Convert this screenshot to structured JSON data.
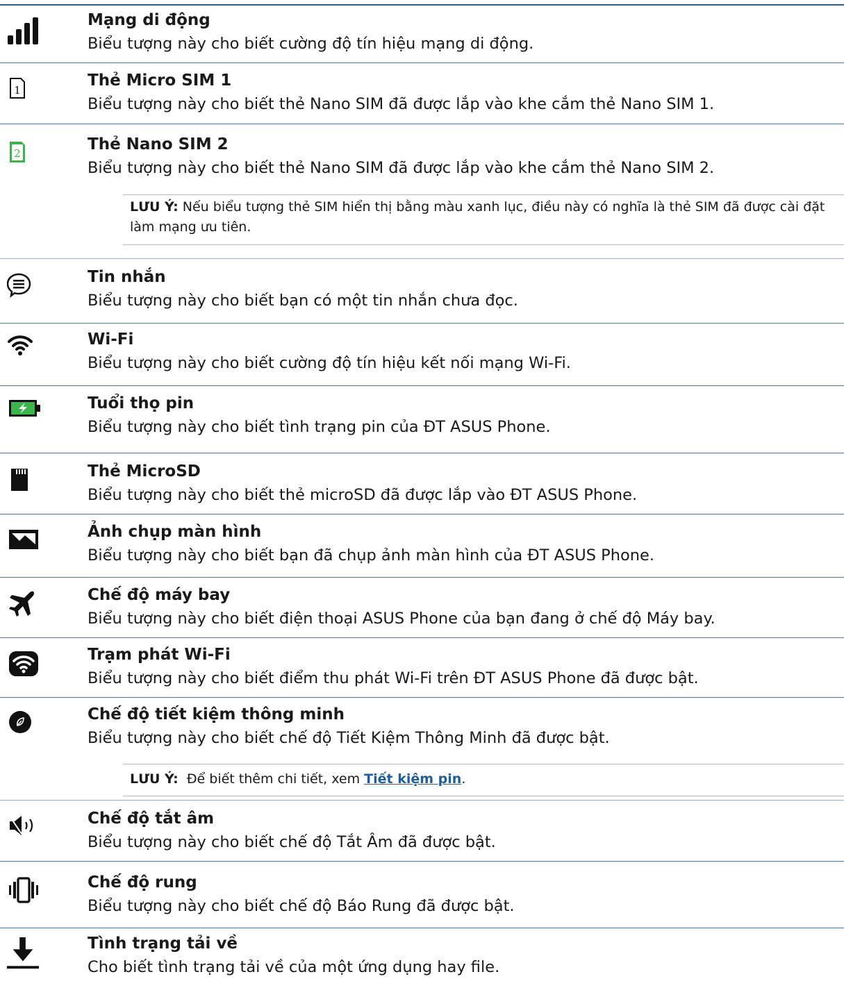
{
  "entries": [
    {
      "icon": "signal-bars-icon",
      "title": "Mạng di động",
      "desc": "Biểu tượng này cho biết cường độ tín hiệu mạng di động."
    },
    {
      "icon": "sim-1-icon",
      "title": "Thẻ Micro SIM 1",
      "desc": "Biểu tượng này cho biết thẻ Nano SIM đã được lắp vào khe cắm thẻ Nano SIM 1."
    },
    {
      "icon": "sim-2-icon",
      "title": "Thẻ Nano SIM  2",
      "desc": "Biểu tượng này cho biết thẻ Nano SIM đã được lắp vào khe cắm thẻ Nano SIM 2."
    },
    {
      "icon": "message-bubble-icon",
      "title": "Tin nhắn",
      "desc": "Biểu tượng này cho biết bạn có một tin nhắn chưa đọc."
    },
    {
      "icon": "wifi-icon",
      "title": "Wi-Fi",
      "desc": "Biểu tượng này cho biết cường độ tín hiệu kết nối mạng Wi-Fi."
    },
    {
      "icon": "battery-charging-icon",
      "title": "Tuổi thọ pin",
      "desc": "Biểu tượng này cho biết tình trạng pin của ĐT ASUS Phone."
    },
    {
      "icon": "microsd-card-icon",
      "title": "Thẻ MicroSD",
      "desc": "Biểu tượng này cho biết thẻ microSD đã được lắp vào ĐT ASUS Phone."
    },
    {
      "icon": "screenshot-image-icon",
      "title": "Ảnh chụp màn hình",
      "desc": "Biểu tượng này cho biết bạn đã chụp ảnh màn hình của ĐT ASUS Phone."
    },
    {
      "icon": "airplane-icon",
      "title": "Chế độ máy bay",
      "desc": "Biểu tượng này cho biết điện thoại ASUS Phone của bạn đang ở chế độ Máy bay."
    },
    {
      "icon": "wifi-hotspot-icon",
      "title": "Trạm phát Wi-Fi",
      "desc": "Biểu tượng này cho biết điểm thu phát Wi-Fi trên ĐT ASUS Phone đã được bật."
    },
    {
      "icon": "smart-saving-leaf-icon",
      "title": "Chế độ tiết kiệm thông minh",
      "desc": "Biểu tượng này cho biết chế độ Tiết Kiệm Thông Minh đã được bật."
    },
    {
      "icon": "speaker-muted-icon",
      "title": "Chế độ tắt âm",
      "desc": "Biểu tượng này cho biết chế độ Tắt Âm đã được bật."
    },
    {
      "icon": "vibrate-phone-icon",
      "title": "Chế độ rung",
      "desc": "Biểu tượng này cho biết chế độ Báo Rung đã được bật."
    },
    {
      "icon": "download-arrow-icon",
      "title": "Tình trạng tải về",
      "desc": "Cho biết tình trạng tải về của một ứng dụng hay file."
    }
  ],
  "note1": {
    "label": "LƯU Ý:",
    "text": " Nếu biểu tượng thẻ SIM hiển thị bằng màu xanh lục, điều này có nghĩa là thẻ SIM đã được cài đặt làm mạng ưu tiên."
  },
  "note2": {
    "label": "LƯU Ý:",
    "prefix": "  Để biết thêm chi tiết, xem ",
    "link": "Tiết kiệm pin",
    "suffix": "."
  },
  "colors": {
    "rule": "#4d7aa8",
    "sim2": "#3ab54a",
    "link": "#1d5e9c"
  }
}
